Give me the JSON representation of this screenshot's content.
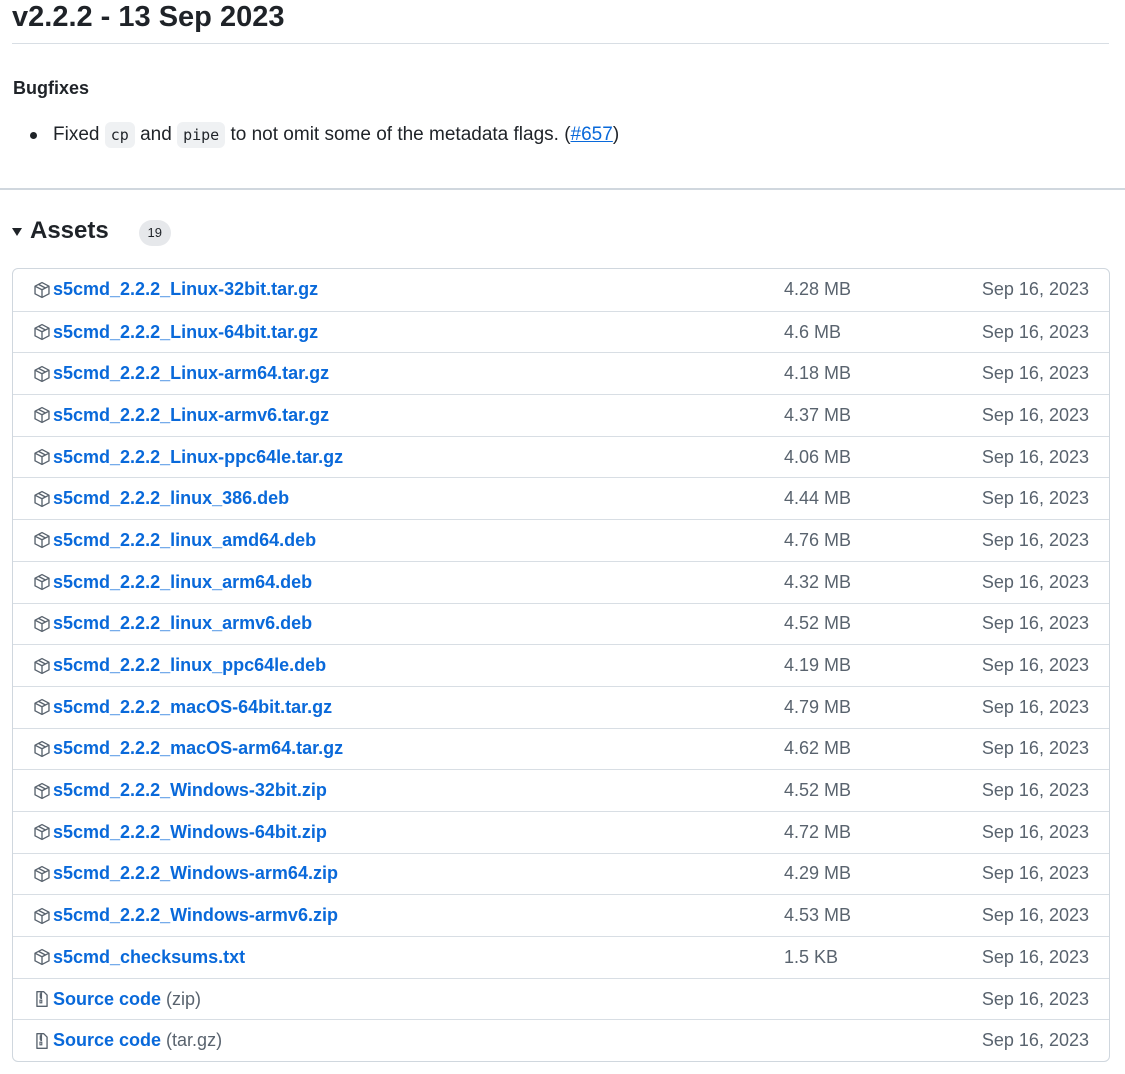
{
  "release": {
    "title": "v2.2.2 - 13 Sep 2023"
  },
  "notes": {
    "heading": "Bugfixes",
    "items": [
      {
        "prefix": "Fixed",
        "code1": "cp",
        "and": "and",
        "code2": "pipe",
        "text": "to not omit some of the metadata flags. (",
        "link": "#657",
        "suffix": ")"
      }
    ]
  },
  "assets": {
    "heading": "Assets",
    "count": "19",
    "colors": {
      "link": "#0969da",
      "muted": "#59636e",
      "border": "#d0d7de"
    },
    "items": [
      {
        "name": "s5cmd_2.2.2_Linux-32bit.tar.gz",
        "size": "4.28 MB",
        "date": "Sep 16, 2023",
        "icon": "package-icon"
      },
      {
        "name": "s5cmd_2.2.2_Linux-64bit.tar.gz",
        "size": "4.6 MB",
        "date": "Sep 16, 2023",
        "icon": "package-icon"
      },
      {
        "name": "s5cmd_2.2.2_Linux-arm64.tar.gz",
        "size": "4.18 MB",
        "date": "Sep 16, 2023",
        "icon": "package-icon"
      },
      {
        "name": "s5cmd_2.2.2_Linux-armv6.tar.gz",
        "size": "4.37 MB",
        "date": "Sep 16, 2023",
        "icon": "package-icon"
      },
      {
        "name": "s5cmd_2.2.2_Linux-ppc64le.tar.gz",
        "size": "4.06 MB",
        "date": "Sep 16, 2023",
        "icon": "package-icon"
      },
      {
        "name": "s5cmd_2.2.2_linux_386.deb",
        "size": "4.44 MB",
        "date": "Sep 16, 2023",
        "icon": "package-icon"
      },
      {
        "name": "s5cmd_2.2.2_linux_amd64.deb",
        "size": "4.76 MB",
        "date": "Sep 16, 2023",
        "icon": "package-icon"
      },
      {
        "name": "s5cmd_2.2.2_linux_arm64.deb",
        "size": "4.32 MB",
        "date": "Sep 16, 2023",
        "icon": "package-icon"
      },
      {
        "name": "s5cmd_2.2.2_linux_armv6.deb",
        "size": "4.52 MB",
        "date": "Sep 16, 2023",
        "icon": "package-icon"
      },
      {
        "name": "s5cmd_2.2.2_linux_ppc64le.deb",
        "size": "4.19 MB",
        "date": "Sep 16, 2023",
        "icon": "package-icon"
      },
      {
        "name": "s5cmd_2.2.2_macOS-64bit.tar.gz",
        "size": "4.79 MB",
        "date": "Sep 16, 2023",
        "icon": "package-icon"
      },
      {
        "name": "s5cmd_2.2.2_macOS-arm64.tar.gz",
        "size": "4.62 MB",
        "date": "Sep 16, 2023",
        "icon": "package-icon"
      },
      {
        "name": "s5cmd_2.2.2_Windows-32bit.zip",
        "size": "4.52 MB",
        "date": "Sep 16, 2023",
        "icon": "package-icon"
      },
      {
        "name": "s5cmd_2.2.2_Windows-64bit.zip",
        "size": "4.72 MB",
        "date": "Sep 16, 2023",
        "icon": "package-icon"
      },
      {
        "name": "s5cmd_2.2.2_Windows-arm64.zip",
        "size": "4.29 MB",
        "date": "Sep 16, 2023",
        "icon": "package-icon"
      },
      {
        "name": "s5cmd_2.2.2_Windows-armv6.zip",
        "size": "4.53 MB",
        "date": "Sep 16, 2023",
        "icon": "package-icon"
      },
      {
        "name": "s5cmd_checksums.txt",
        "size": "1.5 KB",
        "date": "Sep 16, 2023",
        "icon": "package-icon"
      },
      {
        "name": "Source code",
        "suffix": "(zip)",
        "size": "",
        "date": "Sep 16, 2023",
        "icon": "file-zip-icon"
      },
      {
        "name": "Source code",
        "suffix": "(tar.gz)",
        "size": "",
        "date": "Sep 16, 2023",
        "icon": "file-zip-icon"
      }
    ]
  }
}
